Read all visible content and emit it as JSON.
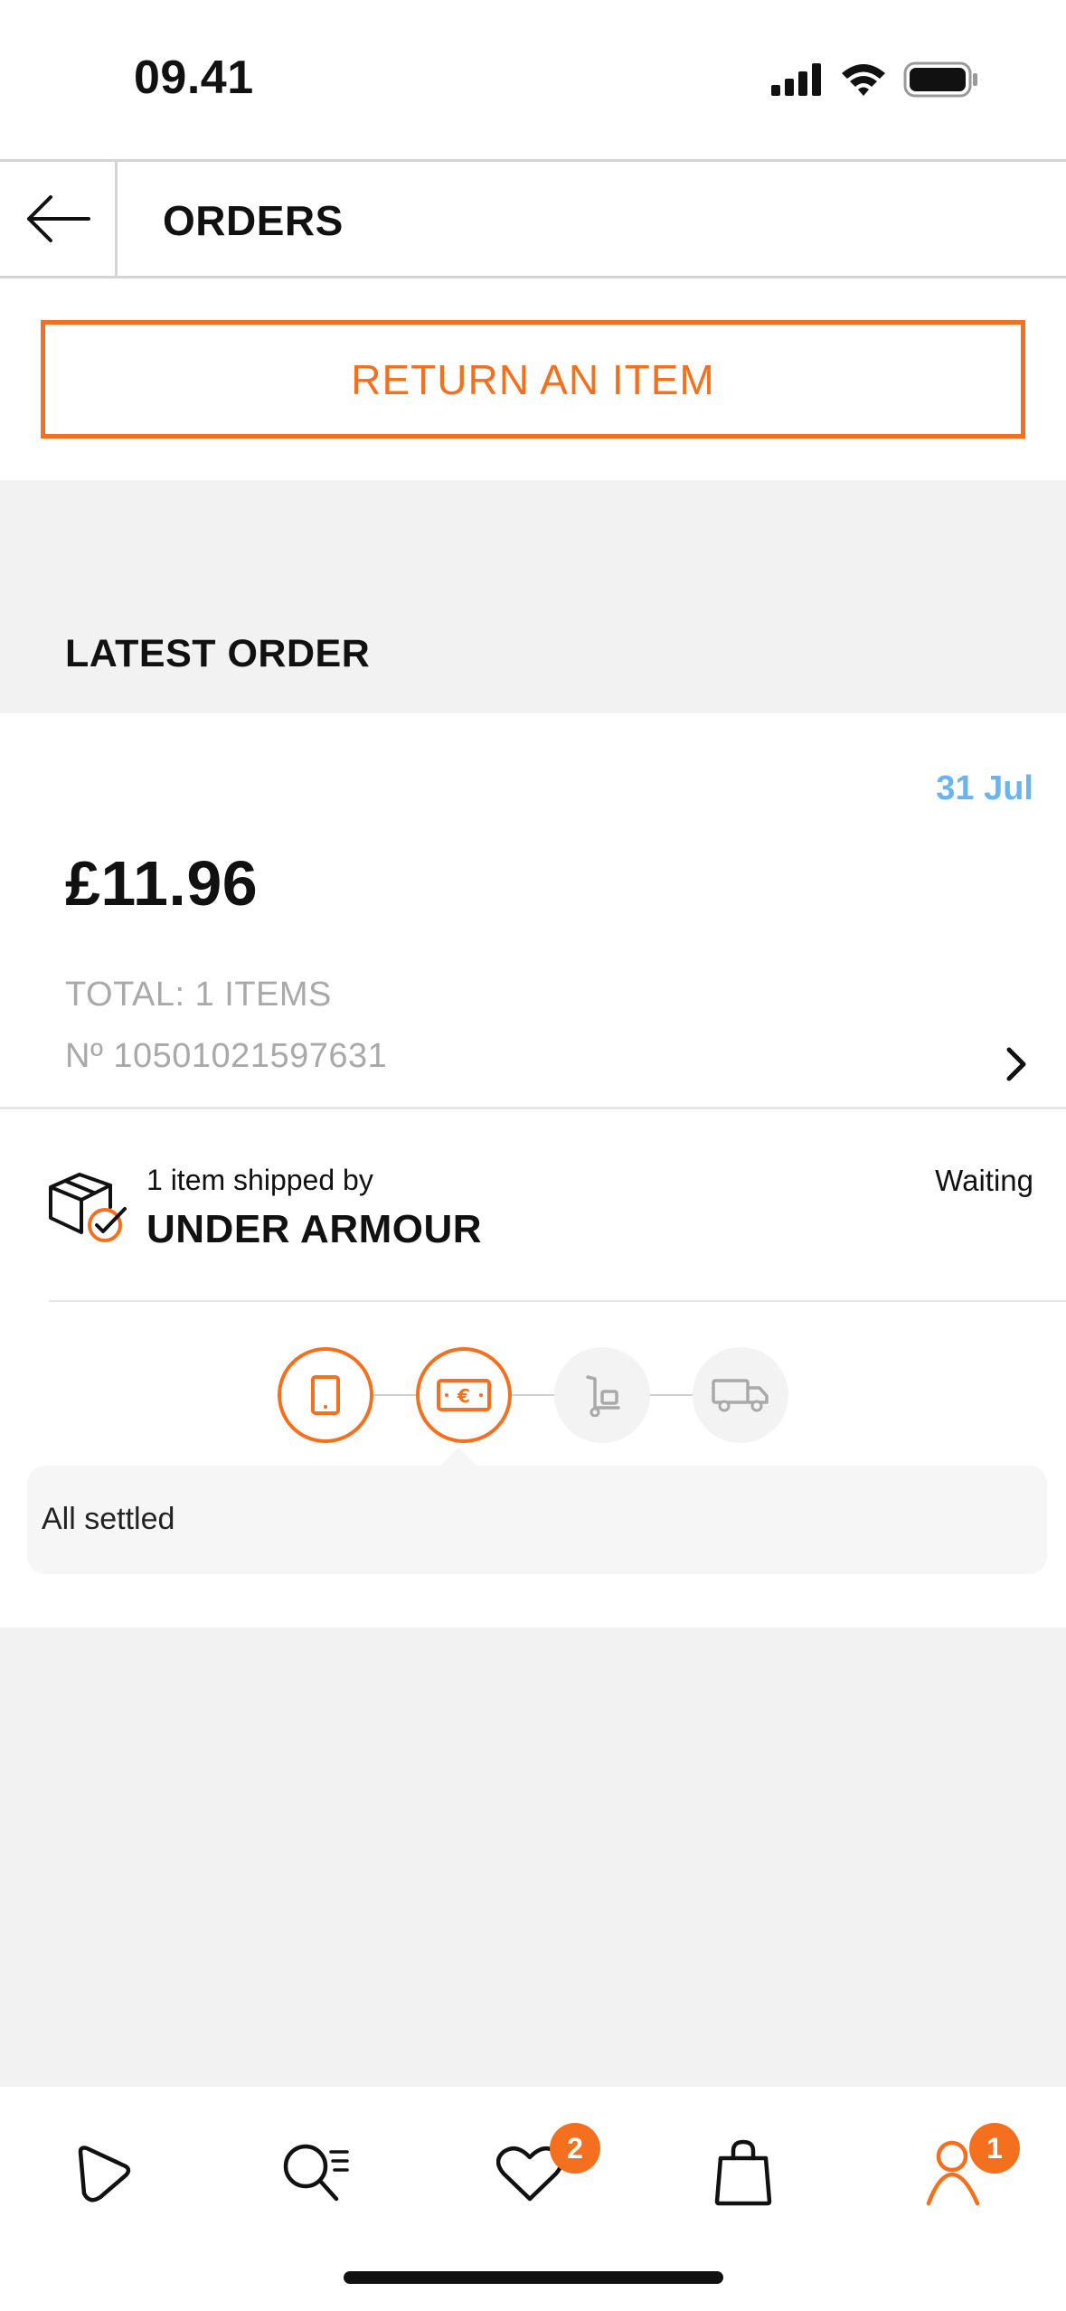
{
  "status_bar": {
    "time": "09.41"
  },
  "header": {
    "title": "ORDERS"
  },
  "actions": {
    "return_label": "RETURN AN ITEM"
  },
  "latest_order": {
    "section_title": "LATEST ORDER",
    "date": "31 Jul",
    "price": "£11.96",
    "total": "TOTAL: 1 ITEMS",
    "number": "Nº 10501021597631"
  },
  "shipment": {
    "shipped_by_label": "1 item shipped by",
    "brand": "UNDER ARMOUR",
    "status": "Waiting",
    "status_message": "All settled",
    "steps": [
      {
        "icon": "phone-order-icon",
        "state": "active"
      },
      {
        "icon": "payment-banknote-icon",
        "state": "active"
      },
      {
        "icon": "warehouse-trolley-icon",
        "state": "pending"
      },
      {
        "icon": "delivery-truck-icon",
        "state": "pending"
      }
    ]
  },
  "tab_bar": {
    "items": [
      {
        "name": "home",
        "icon": "home-play-icon"
      },
      {
        "name": "search",
        "icon": "search-list-icon"
      },
      {
        "name": "wishlist",
        "icon": "heart-icon",
        "badge": "2"
      },
      {
        "name": "bag",
        "icon": "shopping-bag-icon"
      },
      {
        "name": "account",
        "icon": "user-icon",
        "badge": "1"
      }
    ]
  },
  "colors": {
    "accent": "#f4701f",
    "date_blue": "#6cb4ee",
    "muted": "#a9a9a9",
    "section_bg": "#f2f2f2"
  }
}
